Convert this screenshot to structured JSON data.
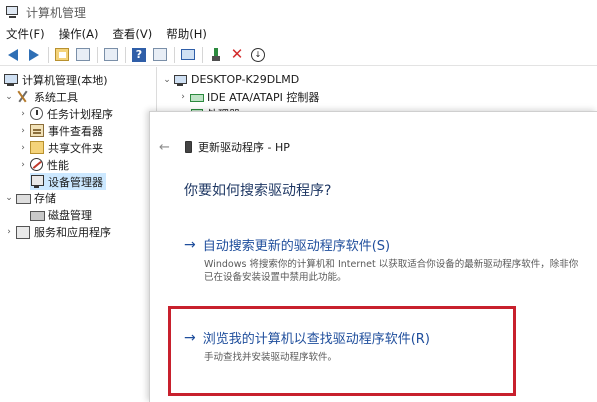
{
  "titlebar": {
    "title": "计算机管理",
    "icon": "computer-management-icon"
  },
  "menubar": {
    "items": [
      "文件(F)",
      "操作(A)",
      "查看(V)",
      "帮助(H)"
    ]
  },
  "toolbar": {
    "buttons": [
      "back",
      "forward",
      "up-folder",
      "properties",
      "view",
      "help",
      "show-hide",
      "update-driver",
      "uninstall",
      "scan-hardware"
    ],
    "help_glyph": "?",
    "uninstall_glyph": "✕",
    "download_glyph": "↓"
  },
  "tree": {
    "root": "计算机管理(本地)",
    "system_tools": "系统工具",
    "task_scheduler": "任务计划程序",
    "event_viewer": "事件查看器",
    "shared_folders": "共享文件夹",
    "performance": "性能",
    "device_manager": "设备管理器",
    "storage": "存储",
    "disk_management": "磁盘管理",
    "services": "服务和应用程序",
    "expander_open": "⌄",
    "expander_closed": "›",
    "selected": "设备管理器"
  },
  "device_list": {
    "computer": "DESKTOP-K29DLMD",
    "items": [
      "IDE ATA/ATAPI 控制器",
      "处理器"
    ],
    "expander_open": "⌄",
    "expander_closed": "›"
  },
  "dialog": {
    "back_glyph": "←",
    "title": "更新驱动程序 - HP",
    "question": "你要如何搜索驱动程序?",
    "arrow_glyph": "→",
    "auto_option": {
      "label": "自动搜索更新的驱动程序软件(S)",
      "description": "Windows 将搜索你的计算机和 Internet 以获取适合你设备的最新驱动程序软件，除非你已在设备安装设置中禁用此功能。"
    },
    "browse_option": {
      "label": "浏览我的计算机以查找驱动程序软件(R)",
      "description": "手动查找并安装驱动程序软件。"
    },
    "highlight_color": "#c8202d"
  }
}
